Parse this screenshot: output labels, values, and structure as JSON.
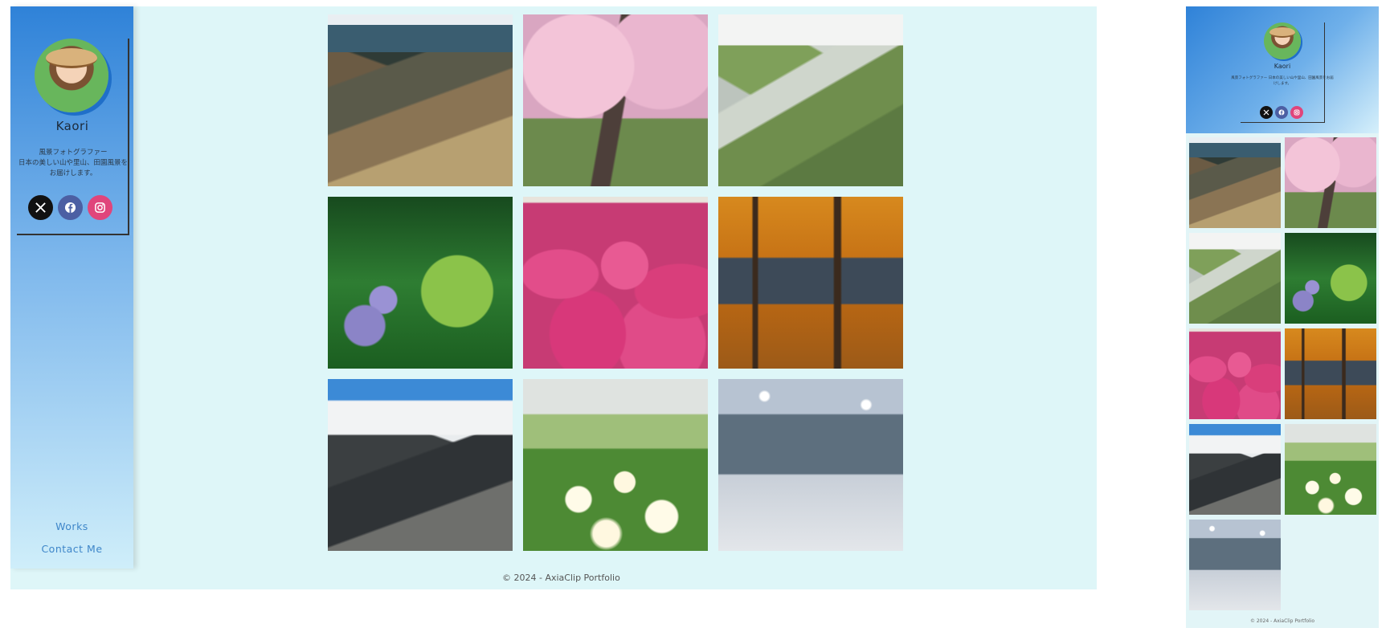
{
  "profile": {
    "name": "Kaori",
    "bio": "風景フォトグラファー\n日本の美しい山や里山、田園風景をお届けします。",
    "socials": [
      {
        "name": "x",
        "label": "X"
      },
      {
        "name": "facebook",
        "label": "Facebook"
      },
      {
        "name": "instagram",
        "label": "Instagram"
      }
    ]
  },
  "nav": {
    "works_label": "Works",
    "contact_label": "Contact Me"
  },
  "gallery": [
    {
      "subject": "mountain-ridge",
      "class": "p-mountain1"
    },
    {
      "subject": "weeping-cherry-tree",
      "class": "p-sakura"
    },
    {
      "subject": "green-mountain-ridge",
      "class": "p-ridge"
    },
    {
      "subject": "hydrangea-forest",
      "class": "p-hydrangea"
    },
    {
      "subject": "pink-kochia-field",
      "class": "p-kochia"
    },
    {
      "subject": "autumn-forest",
      "class": "p-autumn"
    },
    {
      "subject": "rocky-peak",
      "class": "p-peak"
    },
    {
      "subject": "white-alpine-flowers",
      "class": "p-anemone"
    },
    {
      "subject": "snowy-forest",
      "class": "p-snow"
    }
  ],
  "footer": {
    "text": "© 2024 - AxiaClip Portfolio"
  },
  "colors": {
    "sidebar_top": "#2f82d8",
    "page_bg": "#def6f8",
    "nav_link": "#3e86c9",
    "x": "#111111",
    "facebook": "#4c5fa3",
    "instagram": "#e0457b"
  }
}
